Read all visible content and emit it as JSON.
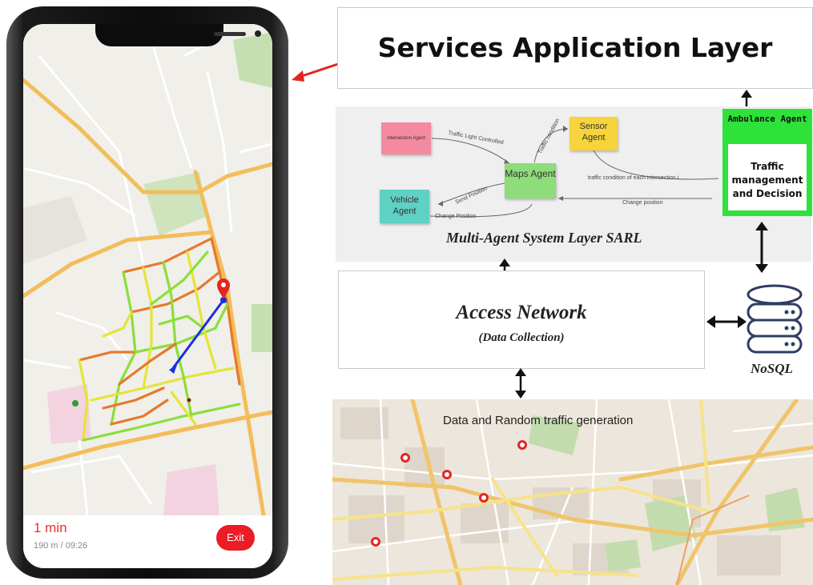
{
  "phone": {
    "eta_time": "1 min",
    "eta_detail": "190 m  /  09:26",
    "exit_label": "Exit"
  },
  "services": {
    "title": "Services Application Layer"
  },
  "mas": {
    "title": "Multi-Agent System Layer SARL",
    "agents": {
      "intersection": "Intersection Agent",
      "sensor": "Sensor Agent",
      "maps": "Maps Agent",
      "vehicle": "Vehicle Agent"
    },
    "edges": {
      "traffic_light": "Traffic Light Controlled",
      "traffic_condition": "Traffic condition",
      "traffic_each": "traffic condition of each intersection i",
      "send_position": "Send Position",
      "change_position_1": "Change Position",
      "change_position_2": "Change position"
    }
  },
  "ambulance": {
    "title": "Ambulance Agent",
    "body": "Traffic management and Decision"
  },
  "access": {
    "title": "Access Network",
    "subtitle": "(Data Collection)"
  },
  "storage": {
    "label": "NoSQL"
  },
  "traffic_map": {
    "title": "Data and Random traffic generation"
  },
  "colors": {
    "ambulance_green": "#2ee23a",
    "intersection_note": "#f48aa0",
    "sensor_note": "#f7d33c",
    "maps_note": "#8fdc7a",
    "vehicle_note": "#5fd0c4",
    "route_blue": "#1a2fe0",
    "arrow_red": "#e4251e",
    "db_blue": "#2f3c63"
  }
}
